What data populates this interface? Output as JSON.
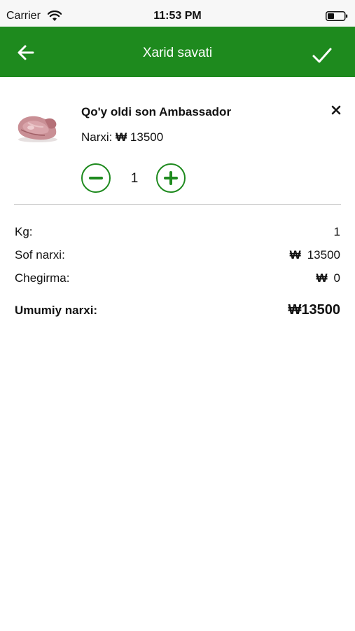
{
  "status_bar": {
    "carrier": "Carrier",
    "time": "11:53 PM",
    "icons": [
      "wifi-icon",
      "battery-icon"
    ]
  },
  "nav": {
    "title": "Xarid savati",
    "back_icon": "arrow-left-icon",
    "confirm_icon": "checkmark-icon",
    "background_color": "#1e8a1e"
  },
  "cart": {
    "items": [
      {
        "name": "Qo'y oldi son Ambassador",
        "price_label": "Narxi:",
        "currency": "₩",
        "price": "13500",
        "quantity": "1",
        "image": "meat-product-image",
        "remove_icon": "close-icon",
        "decrease_icon": "minus-circle-icon",
        "increase_icon": "plus-circle-icon"
      }
    ]
  },
  "summary": {
    "kg_label": "Kg:",
    "kg_value": "1",
    "net_price_label": "Sof narxi:",
    "net_price_currency": "₩",
    "net_price_value": "13500",
    "discount_label": "Chegirma:",
    "discount_currency": "₩",
    "discount_value": "0",
    "total_label": "Umumiy narxi:",
    "total_currency": "₩",
    "total_value": "13500"
  },
  "accent_color": "#1e8a1e"
}
